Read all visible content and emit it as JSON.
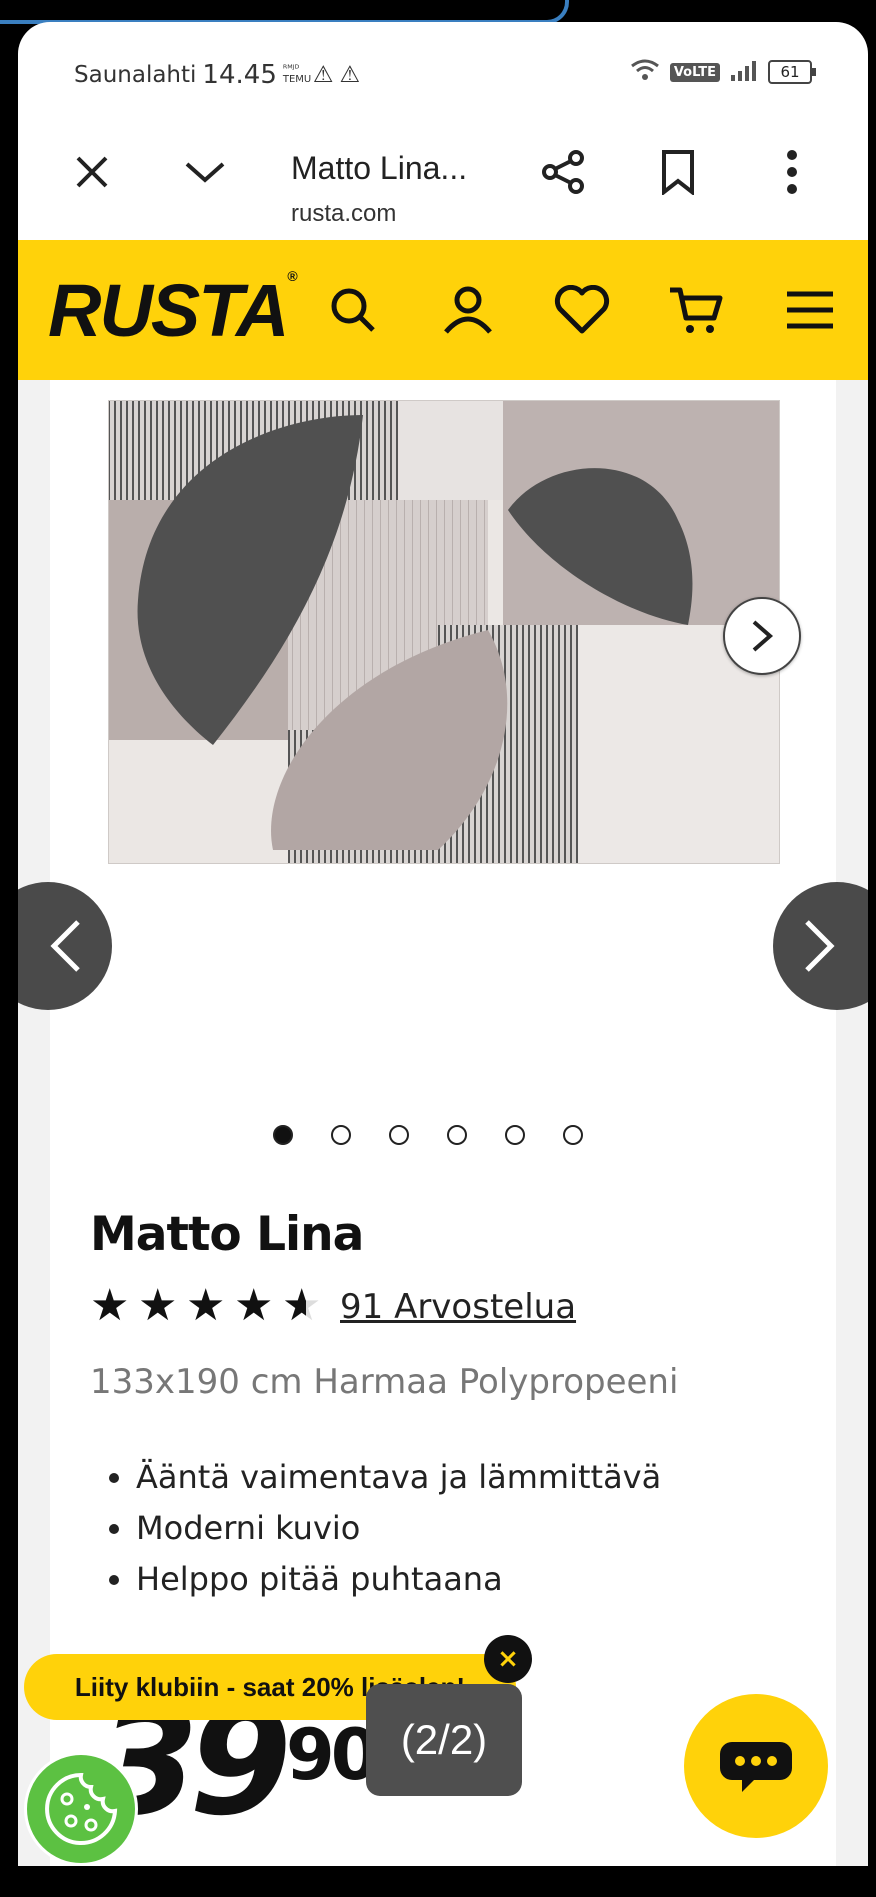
{
  "status_bar": {
    "carrier": "Saunalahti",
    "time": "14.45",
    "small_icon_text": "ᴿᴹᴶᴰ\nTEMU",
    "volte": "VoLTE",
    "battery": "61"
  },
  "browser": {
    "title": "Matto Lina...",
    "url": "rusta.com"
  },
  "header": {
    "logo": "RUSTA",
    "logo_mark": "®"
  },
  "gallery": {
    "dots_count": 6,
    "active_dot": 0
  },
  "product": {
    "title": "Matto Lina",
    "rating": 4.5,
    "reviews_label": "91 Arvostelua",
    "subtitle": "133x190 cm Harmaa Polypropeeni",
    "bullets": [
      "Ääntä vaimentava ja lämmittävä",
      "Moderni kuvio",
      "Helppo pitää puhtaana"
    ],
    "price_int": "39",
    "price_dec": "90"
  },
  "club_banner": {
    "text": "Liity klubiin - saat 20% lisäalen!",
    "close": "×"
  },
  "pager": {
    "label": "(2/2)"
  },
  "icons": [
    "close-icon",
    "chevron-down-icon",
    "share-icon",
    "bookmark-icon",
    "more-icon",
    "search-icon",
    "account-icon",
    "heart-icon",
    "cart-icon",
    "menu-icon",
    "chevron-right-icon",
    "chevron-left-icon",
    "chat-icon",
    "cookie-icon"
  ],
  "colors": {
    "brand_yellow": "#ffd20a",
    "cookie_green": "#5cc142",
    "nav_dark": "#4a4a4a"
  }
}
